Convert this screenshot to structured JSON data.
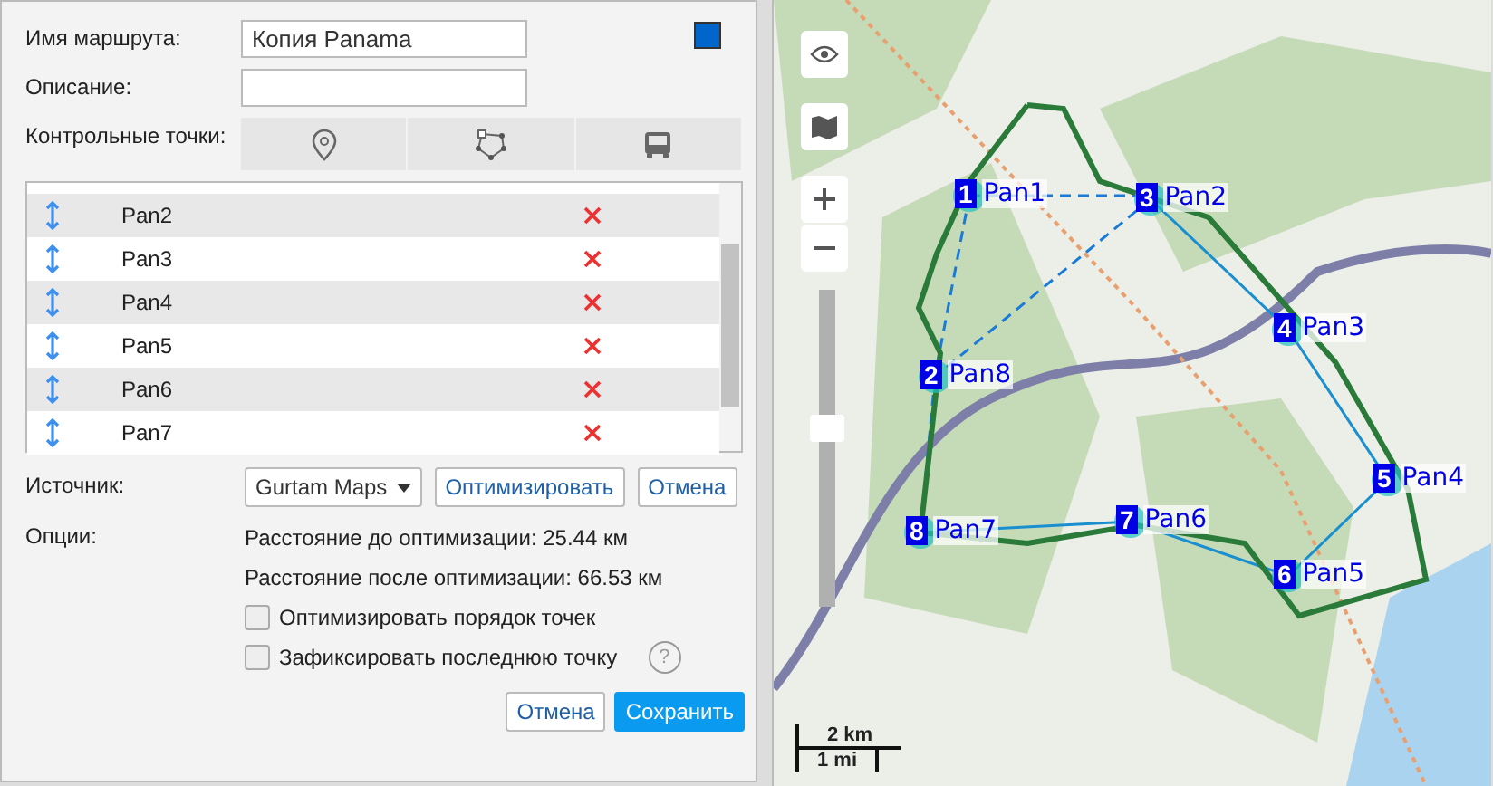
{
  "form": {
    "name_label": "Имя маршрута:",
    "name_value": "Копия Panama",
    "color": "#0066cc",
    "description_label": "Описание:",
    "checkpoints_label": "Контрольные точки:"
  },
  "points": [
    {
      "name": "Pan2"
    },
    {
      "name": "Pan3"
    },
    {
      "name": "Pan4"
    },
    {
      "name": "Pan5"
    },
    {
      "name": "Pan6"
    },
    {
      "name": "Pan7"
    }
  ],
  "source": {
    "label": "Источник:",
    "value": "Gurtam Maps",
    "buttons": [
      "Оптимизировать",
      "Отмена"
    ]
  },
  "options": {
    "label": "Опции:",
    "lines": [
      "Расстояние до оптимизации: 25.44 км",
      "Расстояние после оптимизации: 66.53 км"
    ],
    "checkboxes": [
      {
        "label": "Оптимизировать порядок точек",
        "checked": false
      },
      {
        "label": "Зафиксировать последнюю точку",
        "checked": false,
        "help": "?"
      }
    ]
  },
  "footer": [
    "Отмена",
    "Сохранить"
  ],
  "map": {
    "zoom": {
      "level": 0.57
    },
    "markers": [
      {
        "number": "1",
        "label": "Pan1"
      },
      {
        "number": "3",
        "label": "Pan2"
      },
      {
        "number": "4",
        "label": "Pan3"
      },
      {
        "number": "2",
        "label": "Pan8"
      },
      {
        "number": "5",
        "label": "Pan4"
      },
      {
        "number": "8",
        "label": "Pan7"
      },
      {
        "number": "7",
        "label": "Pan6"
      },
      {
        "number": "6",
        "label": "Pan5"
      }
    ],
    "scale": [
      "2 km",
      "1 mi"
    ]
  }
}
